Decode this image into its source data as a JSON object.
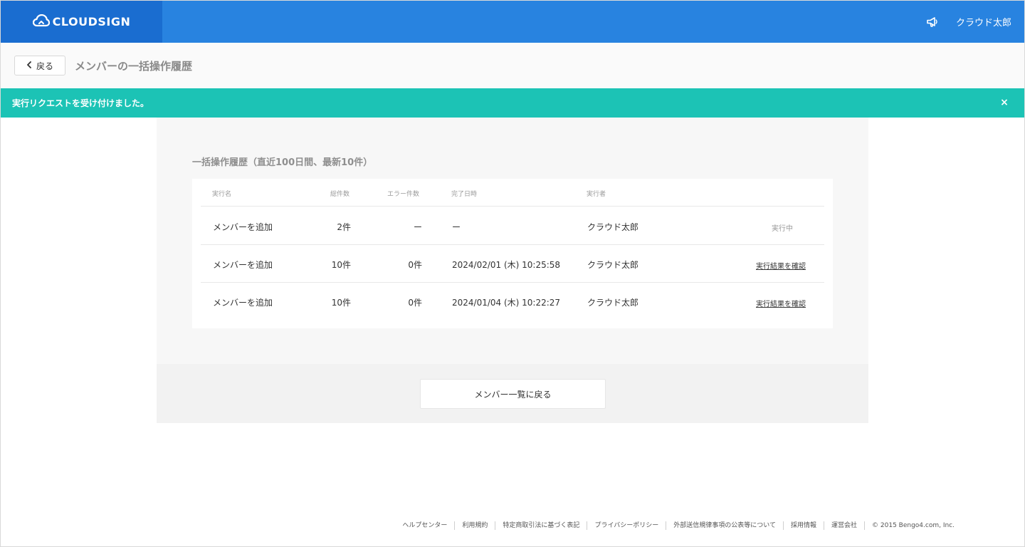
{
  "header": {
    "logo_text": "CLOUDSIGN",
    "user_name": "クラウド太郎",
    "colors": {
      "bar": "#2883e0",
      "logo_bg": "#1a6dd0"
    }
  },
  "title_bar": {
    "back_label": "戻る",
    "page_title": "メンバーの一括操作履歴"
  },
  "toast": {
    "message": "実行リクエストを受け付けました。",
    "close_icon": "×",
    "color": "#1cc3b5"
  },
  "history": {
    "section_title": "一括操作履歴（直近100日間、最新10件）",
    "columns": [
      "実行名",
      "総件数",
      "エラー件数",
      "完了日時",
      "実行者"
    ],
    "rows": [
      {
        "name": "メンバーを追加",
        "total": "2件",
        "errors": "ー",
        "completed_at": "ー",
        "executor": "クラウド太郎",
        "status": "実行中"
      },
      {
        "name": "メンバーを追加",
        "total": "10件",
        "errors": "0件",
        "completed_at": "2024/02/01 (木) 10:25:58",
        "executor": "クラウド太郎",
        "status": "実行結果を確認"
      },
      {
        "name": "メンバーを追加",
        "total": "10件",
        "errors": "0件",
        "completed_at": "2024/01/04 (木) 10:22:27",
        "executor": "クラウド太郎",
        "status": "実行結果を確認"
      }
    ]
  },
  "back_to_list_label": "メンバー一覧に戻る",
  "footer": {
    "links": [
      "ヘルプセンター",
      "利用規約",
      "特定商取引法に基づく表記",
      "プライバシーポリシー",
      "外部送信規律事項の公表等について",
      "採用情報",
      "運営会社"
    ],
    "copyright": "© 2015 Bengo4.com, Inc."
  }
}
